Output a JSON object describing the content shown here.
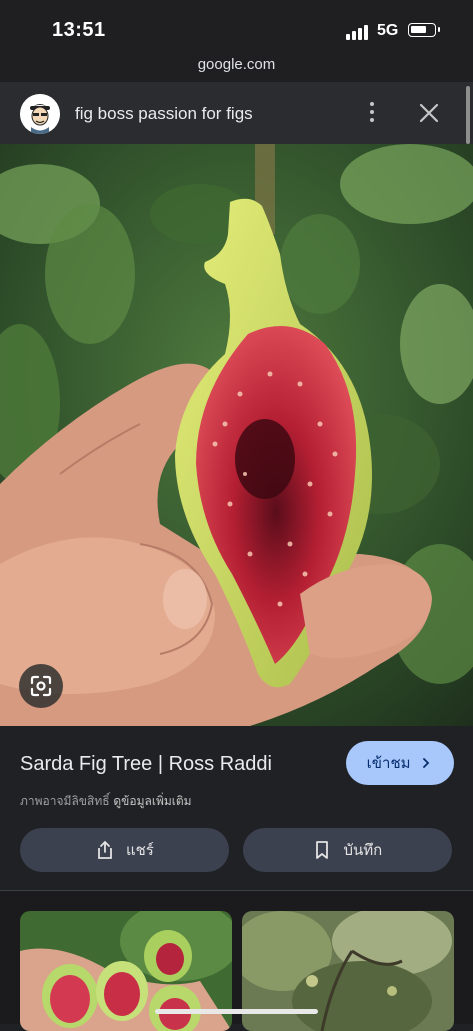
{
  "status_bar": {
    "time": "13:51",
    "network": "5G",
    "battery_level": 0.7
  },
  "browser": {
    "url": "google.com"
  },
  "header": {
    "title": "fig boss passion for figs",
    "menu_icon": "more-vert-icon",
    "close_icon": "close-icon"
  },
  "main_image": {
    "subject": "fig"
  },
  "result": {
    "title": "Sarda Fig Tree | Ross Raddi",
    "visit_label": "เข้าชม",
    "notice_text": "ภาพอาจมีลิขสิทธิ์",
    "notice_link": "ดูข้อมูลเพิ่มเติม",
    "share_label": "แชร์",
    "save_label": "บันทึก"
  },
  "related": [
    {
      "subject": "figs-on-hand"
    },
    {
      "subject": "fig-tree"
    }
  ],
  "colors": {
    "background": "#202124",
    "header": "#2b2c30",
    "accent": "#a8c7fa",
    "pill": "#3c4150"
  }
}
